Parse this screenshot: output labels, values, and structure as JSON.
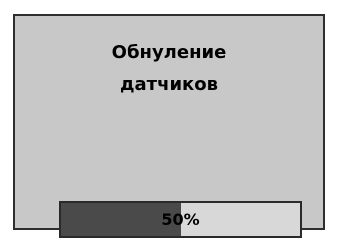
{
  "title": {
    "line1": "Обнуление",
    "line2": "датчиков"
  },
  "progress": {
    "value": 0.5,
    "label": "50%"
  },
  "colors": {
    "screen_bg": "#c8c8c8",
    "border": "#2e2e2e",
    "progress_fill": "#4a4a4a",
    "progress_track": "#d8d8d8",
    "text": "#000000"
  }
}
